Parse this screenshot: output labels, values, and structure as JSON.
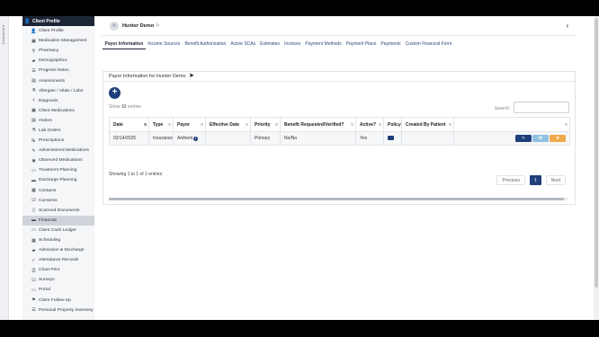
{
  "side_strip": {
    "label": "Dashboard"
  },
  "sidebar": {
    "header": "Client Profile",
    "items": [
      {
        "label": "Client Profile",
        "icon": "person-icon",
        "glyph": "👤"
      },
      {
        "label": "Medication Management",
        "icon": "pills-icon",
        "glyph": "▣"
      },
      {
        "label": "Pharmacy",
        "icon": "search-icon",
        "glyph": "⚲"
      },
      {
        "label": "Demographics",
        "icon": "car-icon",
        "glyph": "▰"
      },
      {
        "label": "Progress Notes",
        "icon": "list-icon",
        "glyph": "☰"
      },
      {
        "label": "Assessments",
        "icon": "document-icon",
        "glyph": "▤"
      },
      {
        "label": "Allergies / Vitals / Labs",
        "icon": "flask-icon",
        "glyph": "⚗"
      },
      {
        "label": "Diagnosis",
        "icon": "stethoscope-icon",
        "glyph": "⚕"
      },
      {
        "label": "Client Medications",
        "icon": "pills-icon",
        "glyph": "▣"
      },
      {
        "label": "Orders",
        "icon": "clipboard-icon",
        "glyph": "▤"
      },
      {
        "label": "Lab Orders",
        "icon": "flask-icon",
        "glyph": "⚗"
      },
      {
        "label": "Prescriptions",
        "icon": "rx-icon",
        "glyph": "℞"
      },
      {
        "label": "Administered Medications",
        "icon": "syringe-icon",
        "glyph": "✎"
      },
      {
        "label": "Observed Medications",
        "icon": "eye-icon",
        "glyph": "◉"
      },
      {
        "label": "Treatment Planning",
        "icon": "folder-icon",
        "glyph": "▭"
      },
      {
        "label": "Discharge Planning",
        "icon": "briefcase-icon",
        "glyph": "▬"
      },
      {
        "label": "Contacts",
        "icon": "contact-card-icon",
        "glyph": "▦"
      },
      {
        "label": "Consents",
        "icon": "checkbox-icon",
        "glyph": "☑"
      },
      {
        "label": "Scanned Documents",
        "icon": "file-icon",
        "glyph": "▯"
      },
      {
        "label": "Financial",
        "icon": "credit-card-icon",
        "glyph": "▬",
        "active": true
      },
      {
        "label": "Client Cash Ledger",
        "icon": "cash-icon",
        "glyph": "▭"
      },
      {
        "label": "Scheduling",
        "icon": "calendar-icon",
        "glyph": "▦"
      },
      {
        "label": "Admission & Discharge",
        "icon": "ambulance-icon",
        "glyph": "▰"
      },
      {
        "label": "Attendance Records",
        "icon": "check-icon",
        "glyph": "✓"
      },
      {
        "label": "Chart Print",
        "icon": "printer-icon",
        "glyph": "⎙"
      },
      {
        "label": "Surveys",
        "icon": "survey-icon",
        "glyph": "☑"
      },
      {
        "label": "Portal",
        "icon": "laptop-icon",
        "glyph": "▭"
      },
      {
        "label": "Client Follow-Up",
        "icon": "walking-icon",
        "glyph": "⚑"
      },
      {
        "label": "Personal Property Inventory",
        "icon": "list-icon",
        "glyph": "☰"
      }
    ]
  },
  "header": {
    "patient_name": "Hunter Demo",
    "flag_glyph": "⚐",
    "chevron_glyph": "›"
  },
  "tabs": [
    {
      "label": "Payor Information",
      "active": true
    },
    {
      "label": "Income Sources"
    },
    {
      "label": "Benefit Authorization"
    },
    {
      "label": "Active SCAs"
    },
    {
      "label": "Estimates"
    },
    {
      "label": "Invoices"
    },
    {
      "label": "Payment Methods"
    },
    {
      "label": "Payment Plans"
    },
    {
      "label": "Payments"
    },
    {
      "label": "Custom Financial Form"
    }
  ],
  "card": {
    "title": "Payor Information for Hunter Demo",
    "add_glyph": "+",
    "show_prefix": "Show",
    "show_count": "10",
    "show_suffix": "entries",
    "search_label": "Search:",
    "search_value": "",
    "columns": [
      "Date",
      "Type",
      "Payor",
      "Effective Date",
      "Priority",
      "Benefit Requested/Verified?",
      "Active?",
      "Policy",
      "Created By Patient",
      ""
    ],
    "rows": [
      {
        "date": "02/14/2025",
        "type": "Insurance",
        "payor": "Anthem",
        "effective_date": "",
        "priority": "Primary",
        "benefit": "No/No",
        "active": "Yes",
        "created_by_patient": "",
        "actions": {
          "edit": "✎",
          "view": "👁",
          "delete": "✖"
        }
      }
    ],
    "showing_text": "Showing 1 to 1 of 1 entries",
    "pager": {
      "previous": "Previous",
      "current": "1",
      "next": "Next"
    }
  },
  "colors": {
    "navy": "#1f3f7a",
    "sidebar_head": "#1d2636",
    "view_button": "#8fc2e0",
    "delete_button": "#f0a94b"
  }
}
